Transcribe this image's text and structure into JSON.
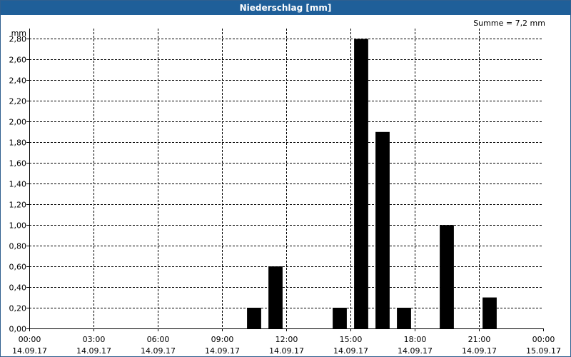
{
  "window": {
    "title": "Niederschlag [mm]"
  },
  "summary": {
    "text": "Summe = 7,2 mm"
  },
  "chart_data": {
    "type": "bar",
    "title": "Niederschlag [mm]",
    "ylabel": "mm",
    "ylim": [
      0,
      2.9
    ],
    "yticks": [
      0,
      0.2,
      0.4,
      0.6,
      0.8,
      1.0,
      1.2,
      1.4,
      1.6,
      1.8,
      2.0,
      2.2,
      2.4,
      2.6,
      2.8
    ],
    "ytick_labels": [
      "0,00",
      "0,20",
      "0,40",
      "0,60",
      "0,80",
      "1,00",
      "1,20",
      "1,40",
      "1,60",
      "1,80",
      "2,00",
      "2,20",
      "2,40",
      "2,60",
      "2,80"
    ],
    "x_range_hours": [
      0,
      24
    ],
    "xticks_hours": [
      0,
      3,
      6,
      9,
      12,
      15,
      18,
      21,
      24
    ],
    "xtick_labels": [
      [
        "00:00",
        "14.09.17"
      ],
      [
        "03:00",
        "14.09.17"
      ],
      [
        "06:00",
        "14.09.17"
      ],
      [
        "09:00",
        "14.09.17"
      ],
      [
        "12:00",
        "14.09.17"
      ],
      [
        "15:00",
        "14.09.17"
      ],
      [
        "18:00",
        "14.09.17"
      ],
      [
        "21:00",
        "14.09.17"
      ],
      [
        "00:00",
        "15.09.17"
      ]
    ],
    "bars": [
      {
        "start": "10:00",
        "end": "11:00",
        "value": 0.2
      },
      {
        "start": "11:00",
        "end": "12:00",
        "value": 0.6
      },
      {
        "start": "14:00",
        "end": "15:00",
        "value": 0.2
      },
      {
        "start": "15:00",
        "end": "16:00",
        "value": 2.8
      },
      {
        "start": "16:00",
        "end": "17:00",
        "value": 1.9
      },
      {
        "start": "17:00",
        "end": "18:00",
        "value": 0.2
      },
      {
        "start": "19:00",
        "end": "20:00",
        "value": 1.0
      },
      {
        "start": "21:00",
        "end": "22:00",
        "value": 0.3
      }
    ],
    "grid": true,
    "bar_color": "#000000"
  }
}
